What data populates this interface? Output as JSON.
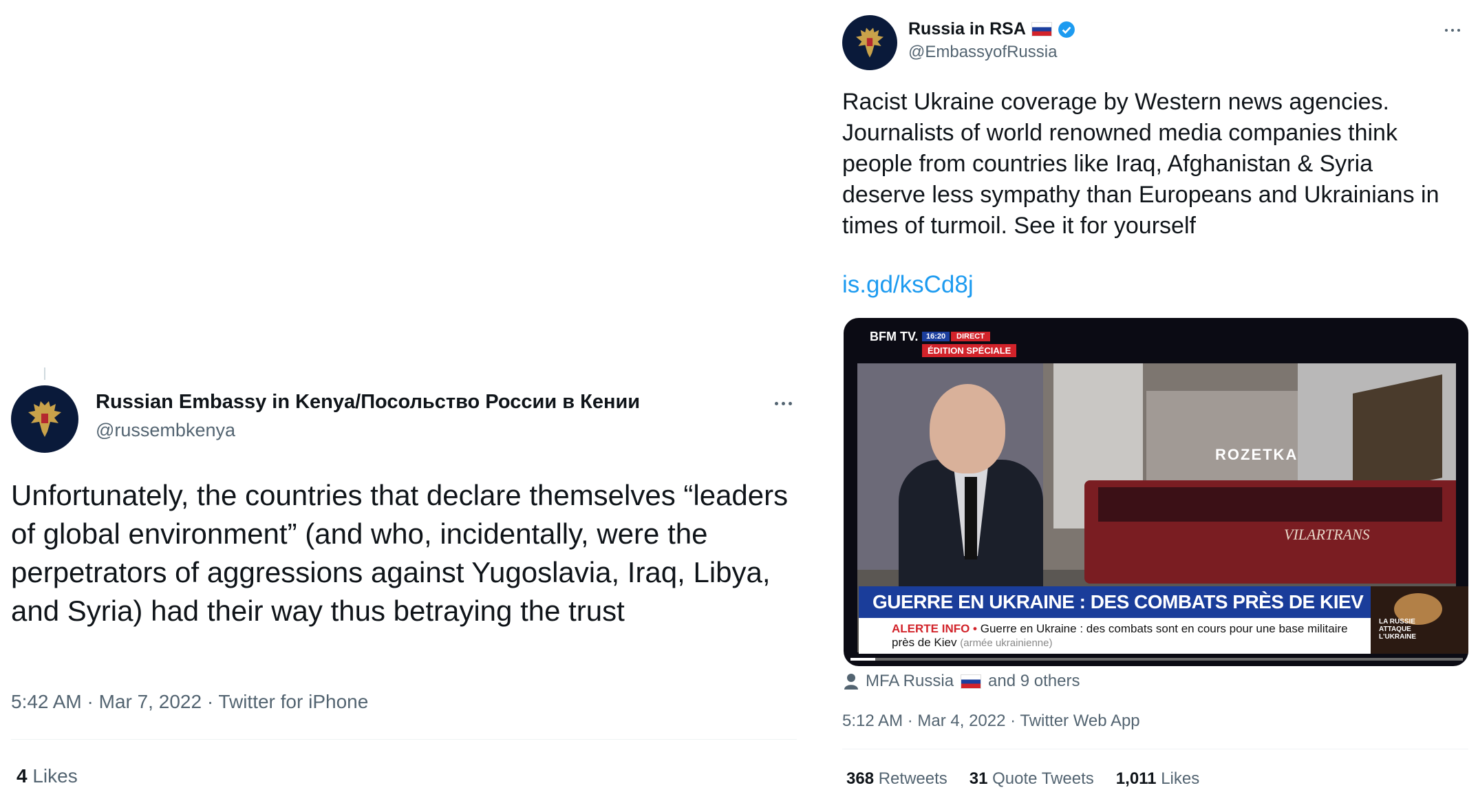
{
  "tweet_left": {
    "display_name": "Russian Embassy in Kenya/Посольство России в Кении",
    "handle": "@russembkenya",
    "text": "Unfortunately, the countries that declare themselves “leaders of global environment” (and who, incidentally, were the perpetrators of aggressions against Yugoslavia, Iraq, Libya, and Syria) had their way thus betraying the trust",
    "time_line": "5:42 AM · Mar 7, 2022 · Twitter for iPhone",
    "likes_count": "4",
    "likes_label": "Likes"
  },
  "tweet_right": {
    "display_name": "Russia in RSA",
    "handle": "@EmbassyofRussia",
    "text": "Racist Ukraine coverage by Western news agencies. Journalists of world renowned media companies think people from countries like Iraq, Afghanistan & Syria deserve less sympathy than Europeans and Ukrainians in times of turmoil. See it for yourself",
    "link": "is.gd/ksCd8j",
    "video": {
      "channel": "BFM TV.",
      "time": "16:20",
      "live_tag": "DIRECT",
      "edition_tag": "ÉDITION SPÉCIALE",
      "sign_text": "ROZETKA",
      "bus_text": "VILARTRANS",
      "headline": "GUERRE EN UKRAINE : DES COMBATS PRÈS DE KIEV",
      "alert_label": "ALERTE INFO •",
      "ticker_text": "Guerre en Ukraine : des combats sont en cours pour une base militaire près de Kiev",
      "ticker_source": "(armée ukrainienne)",
      "corner_text": "LA RUSSIE ATTAQUE L'UKRAINE",
      "progress": 0.04
    },
    "tagged": "MFA Russia",
    "tagged_others": "and 9 others",
    "time_line": "5:12 AM · Mar 4, 2022 · Twitter Web App",
    "stats": [
      {
        "count": "368",
        "label": "Retweets"
      },
      {
        "count": "31",
        "label": "Quote Tweets"
      },
      {
        "count": "1,011",
        "label": "Likes"
      }
    ]
  },
  "colors": {
    "link": "#1d9bf0",
    "verified": "#1d9bf0",
    "secondary_text": "#536471",
    "avatar_bg": "#0a1a3a"
  },
  "icons": [
    "double-headed-eagle-emblem",
    "russia-flag-icon",
    "verified-badge-icon",
    "more-dots-icon",
    "person-icon"
  ]
}
